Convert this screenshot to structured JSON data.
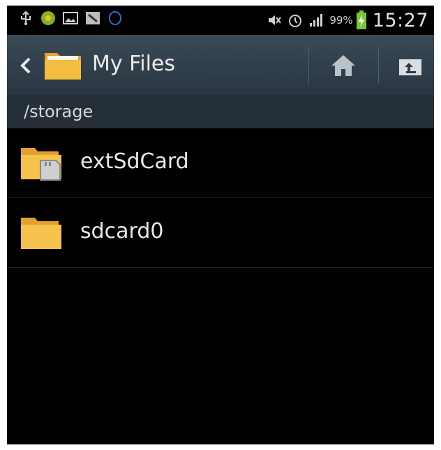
{
  "status_bar": {
    "battery_percent": "99%",
    "time": "15:27"
  },
  "action_bar": {
    "title": "My Files"
  },
  "path_bar": {
    "path": "/storage"
  },
  "files": [
    {
      "name": "extSdCard",
      "icon": "sd-card-folder-icon"
    },
    {
      "name": "sdcard0",
      "icon": "folder-icon"
    }
  ],
  "colors": {
    "action_bar": "#2f3c48",
    "path_bar": "#252f38",
    "folder": "#f0b93a",
    "background": "#000000"
  }
}
